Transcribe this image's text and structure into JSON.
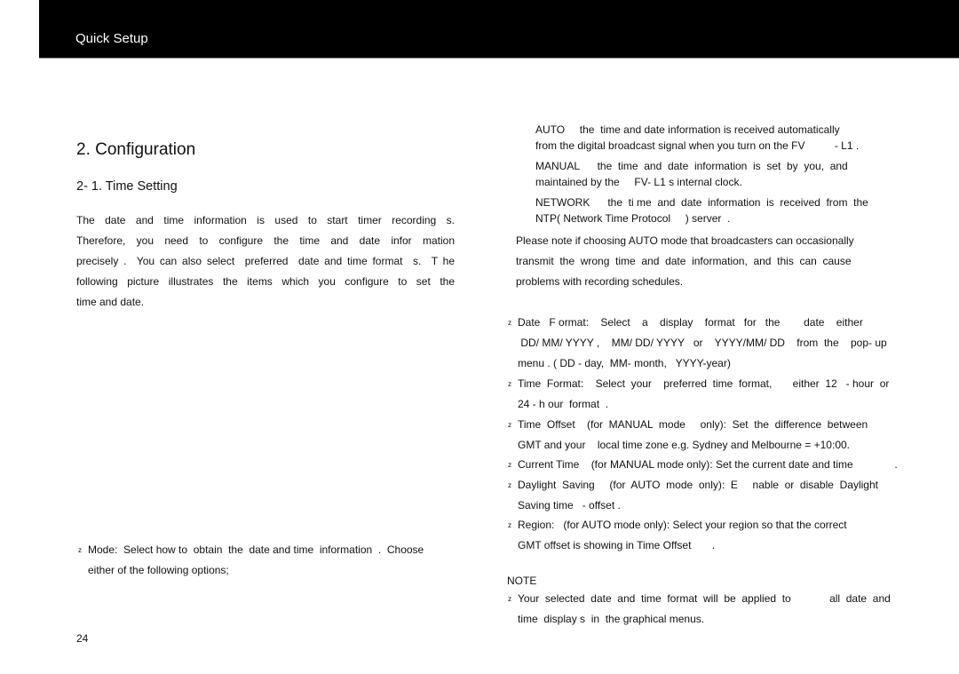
{
  "header": {
    "title": "Quick Setup"
  },
  "section": {
    "heading": "2.  Configuration",
    "subheading": "2- 1.  Time   Setting",
    "intro_lines": [
      "The  date  and  time  information  is  used  to  start  timer  recording  s.",
      "Therefore,  you  need  to  configure  the  time  and  date  infor  mation",
      "precisely .  You can also select  preferred  date and time format  s.  T he",
      "following  picture  illustrates  the  items  which  you  configure  to  set  the",
      "time and date."
    ]
  },
  "mode_item": {
    "bullet": "z",
    "lines": [
      "Mode:  Select how to  obtain  the  date and time  information  .  Choose",
      "either of the following options;"
    ]
  },
  "mode_options": [
    {
      "name": "AUTO",
      "lines": [
        "AUTO     the  time and date information is received automatically",
        "from the digital broadcast signal when you turn on the FV          - L1 ."
      ]
    },
    {
      "name": "MANUAL",
      "lines": [
        "MANUAL      the  time  and  date  information  is  set  by  you,  and",
        "maintained by the     FV- L1 s internal clock."
      ]
    },
    {
      "name": "NETWORK",
      "lines": [
        "NETWORK      the  ti me  and  date  information  is  received  from  the",
        "NTP( Network Time Protocol     ) server  ."
      ]
    }
  ],
  "auto_note_lines": [
    "Please note if choosing AUTO mode that broadcasters can occasionally",
    "transmit  the  wrong  time  and  date  information,  and  this  can  cause",
    "problems with recording schedules."
  ],
  "settings_items": [
    {
      "bullet": "z",
      "lines": [
        "Date   F ormat:    Select    a    display    format   for   the        date    either",
        " DD/ MM/ YYYY ,    MM/ DD/ YYYY   or    YYYY/MM/ DD    from  the    pop- up",
        "menu . ( DD - day,  MM- month,   YYYY-year)"
      ]
    },
    {
      "bullet": "z",
      "lines": [
        "Time  Format:    Select  your    preferred  time  format,       either  12   - hour  or",
        "24 - h our  format  ."
      ]
    },
    {
      "bullet": "z",
      "lines": [
        "Time  Offset    (for  MANUAL  mode     only):  Set  the  difference  between",
        "GMT and your    local time zone e.g. Sydney and Melbourne = +10:00."
      ]
    },
    {
      "bullet": "z",
      "lines": [
        "Current Time    (for MANUAL mode only): Set the current date and time              ."
      ]
    },
    {
      "bullet": "z",
      "lines": [
        "Daylight  Saving     (for  AUTO  mode  only):  E     nable  or  disable  Daylight",
        "Saving time   - offset ."
      ]
    },
    {
      "bullet": "z",
      "lines": [
        "Region:   (for AUTO mode only): Select your region so that the correct",
        "GMT offset is showing in Time Offset       ."
      ]
    }
  ],
  "note": {
    "title": "NOTE",
    "bullet": "z",
    "lines": [
      "Your  selected  date  and  time  format  will  be  applied  to             all  date  and",
      "time  display s  in  the graphical menus."
    ]
  },
  "page_number": "24"
}
